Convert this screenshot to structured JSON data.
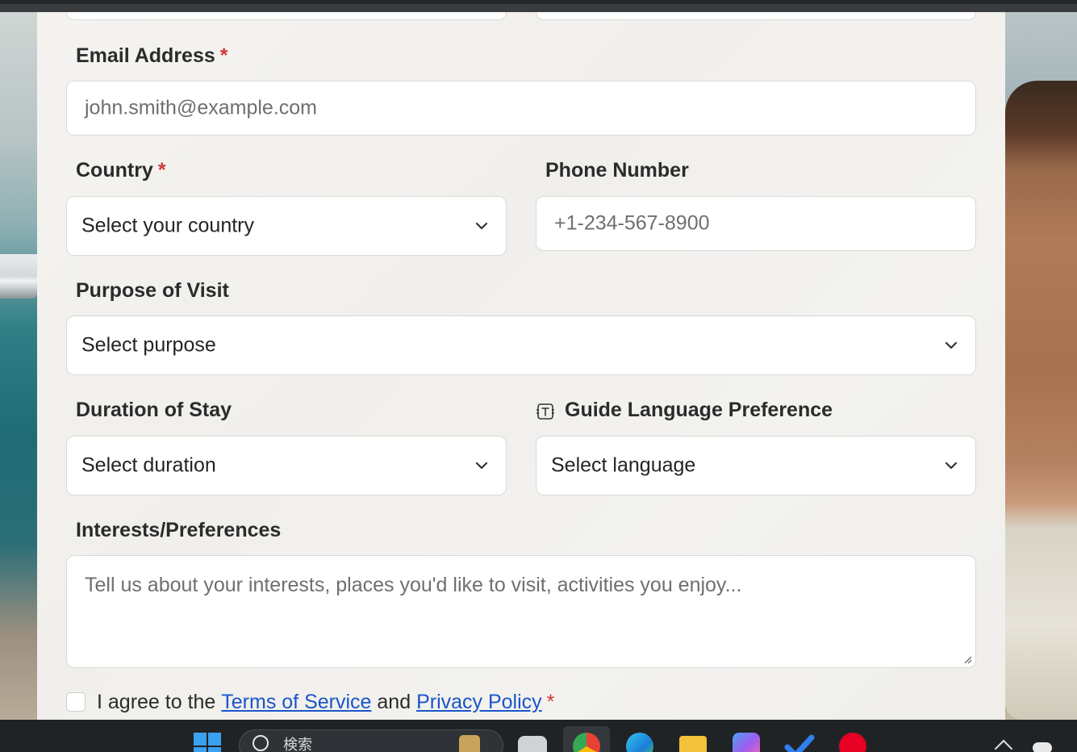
{
  "form": {
    "email": {
      "label": "Email Address",
      "required_mark": "*",
      "placeholder": "john.smith@example.com"
    },
    "country": {
      "label": "Country",
      "required_mark": "*",
      "value": "Select your country"
    },
    "phone": {
      "label": "Phone Number",
      "placeholder": "+1-234-567-8900"
    },
    "purpose": {
      "label": "Purpose of Visit",
      "value": "Select purpose"
    },
    "duration": {
      "label": "Duration of Stay",
      "value": "Select duration"
    },
    "language": {
      "label": "Guide Language Preference",
      "value": "Select language",
      "icon": "language-icon"
    },
    "interests": {
      "label": "Interests/Preferences",
      "placeholder": "Tell us about your interests, places you'd like to visit, activities you enjoy..."
    },
    "agree": {
      "prefix": "I agree to the",
      "terms_link": "Terms of Service",
      "middle": "and",
      "privacy_link": "Privacy Policy",
      "required_mark": "*",
      "checked": false
    }
  },
  "taskbar": {
    "search_text": "検索",
    "apps": [
      "task-view-icon",
      "chrome-icon",
      "edge-icon",
      "file-explorer-icon",
      "copilot-icon",
      "todo-icon",
      "pinterest-icon"
    ]
  },
  "colors": {
    "accent_link": "#1a55c9",
    "required": "#d33a3a",
    "label_text": "#2b2b2b"
  }
}
